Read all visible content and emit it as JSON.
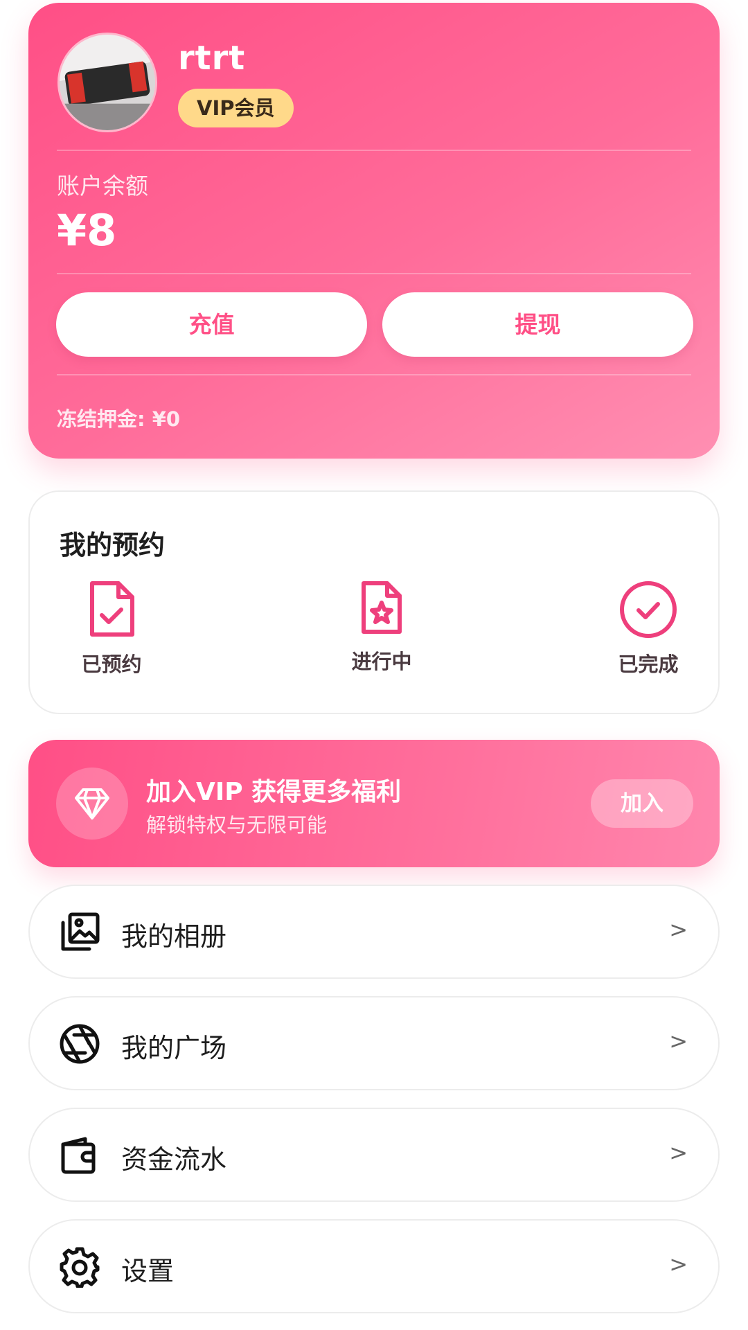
{
  "profile": {
    "username": "rtrt",
    "vip_badge": "VIP会员",
    "balance_label": "账户余额",
    "balance_value": "¥8",
    "recharge_label": "充值",
    "withdraw_label": "提现",
    "frozen_deposit": "冻结押金: ¥0"
  },
  "reservations": {
    "title": "我的预约",
    "items": [
      {
        "label": "已预约",
        "icon": "file-check-icon"
      },
      {
        "label": "进行中",
        "icon": "file-star-icon"
      },
      {
        "label": "已完成",
        "icon": "circle-check-icon"
      }
    ]
  },
  "vip_banner": {
    "title": "加入VIP 获得更多福利",
    "subtitle": "解锁特权与无限可能",
    "join_label": "加入",
    "icon": "diamond-icon"
  },
  "menu": [
    {
      "label": "我的相册",
      "icon": "photo-album-icon",
      "arrow": ">"
    },
    {
      "label": "我的广场",
      "icon": "aperture-icon",
      "arrow": ">"
    },
    {
      "label": "资金流水",
      "icon": "wallet-icon",
      "arrow": ">"
    },
    {
      "label": "设置",
      "icon": "gear-icon",
      "arrow": ">"
    }
  ],
  "colors": {
    "accent": "#ff4f86",
    "vip_badge": "#ffd98a",
    "text_dark": "#1e1e1e"
  }
}
